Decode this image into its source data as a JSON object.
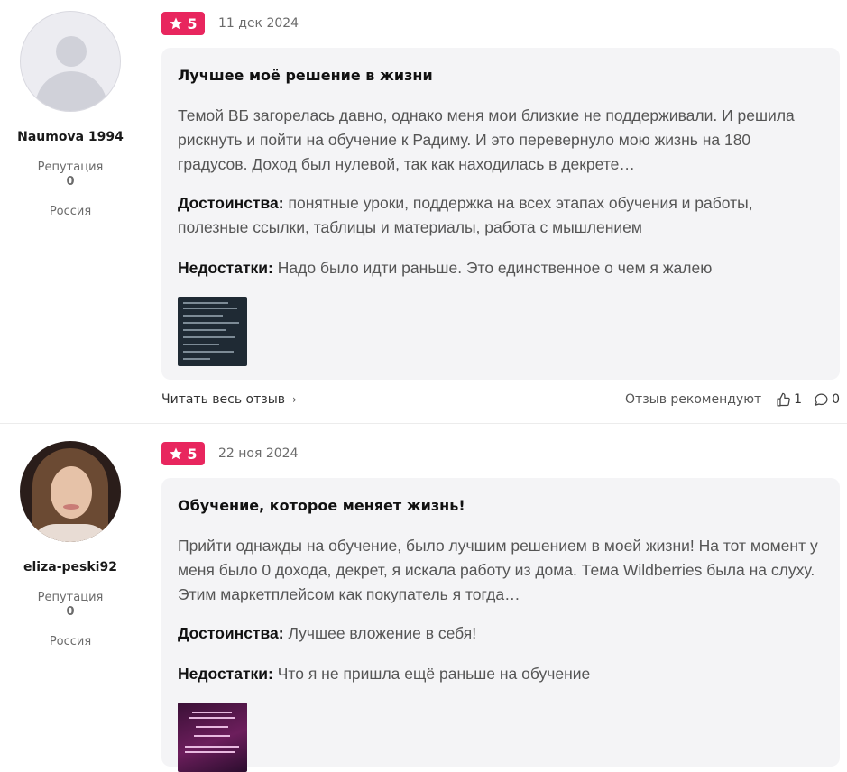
{
  "reviews": [
    {
      "author": {
        "name": "Naumova 1994",
        "reputation_label": "Репутация",
        "reputation_value": "0",
        "country": "Россия",
        "avatar": "default-avatar-icon"
      },
      "rating": "5",
      "date": "11 дек 2024",
      "title": "Лучшее моё решение в жизни",
      "text": "Темой ВБ загорелась давно, однако меня мои близкие не поддерживали. И решила рискнуть и пойти на обучение к Радиму. И это перевернуло мою жизнь на 180 градусов. Доход был нулевой, так как находилась в декрете…",
      "pros_label": "Достоинства:",
      "pros": "понятные уроки, поддержка на всех этапах обучения и работы, полезные ссылки, таблицы и материалы, работа с мышлением",
      "cons_label": "Недостатки:",
      "cons": "Надо было идти раньше. Это единственное о чем я жалею",
      "read_more": "Читать весь отзыв",
      "recommend": "Отзыв рекомендуют",
      "likes": "1",
      "comments": "0"
    },
    {
      "author": {
        "name": "eliza-peski92",
        "reputation_label": "Репутация",
        "reputation_value": "0",
        "country": "Россия",
        "avatar": "user-photo"
      },
      "rating": "5",
      "date": "22 ноя 2024",
      "title": "Обучение, которое меняет жизнь!",
      "text": "Прийти однажды на обучение, было лучшим решением в моей жизни! На тот момент у меня было 0 дохода, декрет, я искала работу из дома. Тема Wildberries была на слуху. Этим маркетплейсом как покупатель я тогда…",
      "pros_label": "Достоинства:",
      "pros": "Лучшее вложение в себя!",
      "cons_label": "Недостатки:",
      "cons": "Что я не пришла ещё раньше на обучение"
    }
  ],
  "colors": {
    "accent": "#e8265e",
    "card_bg": "#f4f4f6",
    "muted_text": "#6b6b6b"
  }
}
